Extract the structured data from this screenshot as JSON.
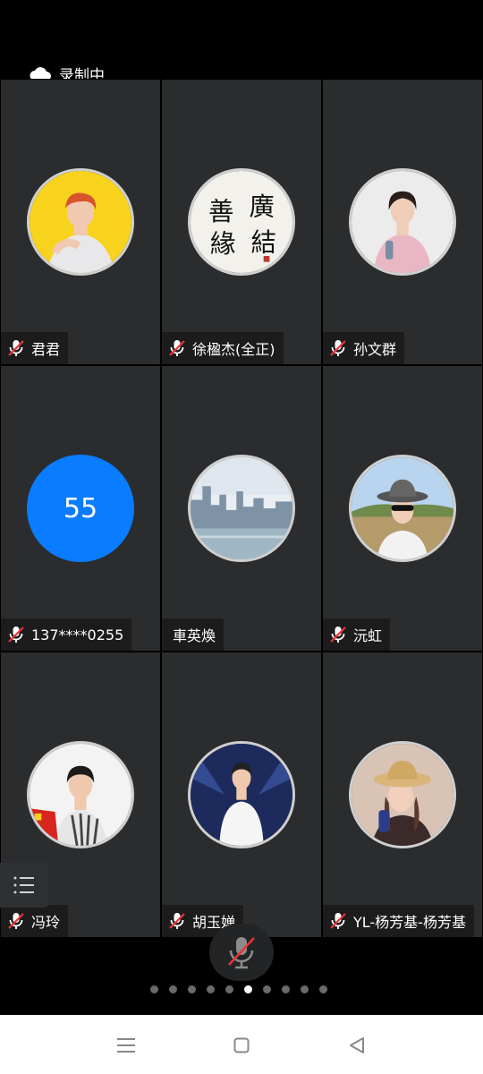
{
  "recording": {
    "label": "录制中",
    "icon": "cloud-icon"
  },
  "participants": [
    {
      "name": "君君",
      "mic": "muted",
      "avatar": "photo-yellow"
    },
    {
      "name": "徐楹杰(全正)",
      "mic": "muted",
      "avatar": "calligraphy",
      "calligraphy_text": [
        "善",
        "廣",
        "緣",
        "結"
      ]
    },
    {
      "name": "孙文群",
      "mic": "muted",
      "avatar": "photo-pink"
    },
    {
      "name": "137****0255",
      "mic": "muted",
      "avatar": "number",
      "avatar_text": "55",
      "avatar_color": "#0a7cff"
    },
    {
      "name": "車英煥",
      "mic": "none",
      "avatar": "photo-city"
    },
    {
      "name": "沅虹",
      "mic": "muted",
      "avatar": "photo-hat"
    },
    {
      "name": "冯玲",
      "mic": "muted",
      "avatar": "photo-flag"
    },
    {
      "name": "胡玉婵",
      "mic": "muted",
      "avatar": "photo-white"
    },
    {
      "name": "YL-杨芳基-杨芳基",
      "mic": "muted",
      "avatar": "photo-straw-hat"
    }
  ],
  "controls": {
    "mic_icon": "mic-muted-icon",
    "menu_icon": "list-menu-icon"
  },
  "pagination": {
    "total": 10,
    "active": 5
  },
  "colors": {
    "tile": "#2b2c2e",
    "mute_red": "#e9343a",
    "accent": "#0a7cff"
  },
  "navbar": {
    "icons": [
      "menu-icon",
      "home-icon",
      "back-icon"
    ]
  }
}
